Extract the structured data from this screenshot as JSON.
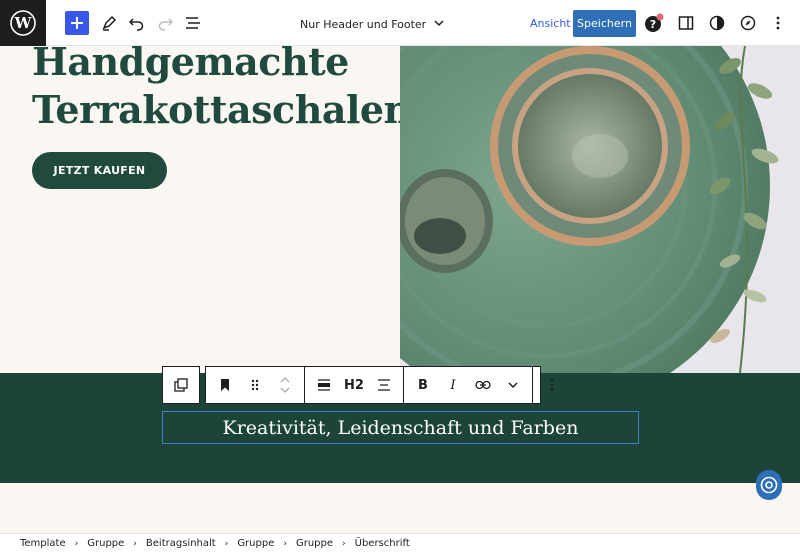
{
  "topbar": {
    "document_title": "Nur Header und Footer",
    "view_label": "Ansicht",
    "save_label": "Speichern"
  },
  "hero": {
    "title_line1": "Handgemachte",
    "title_line2": "Terrakottaschalen",
    "cta_label": "JETZT KAUFEN"
  },
  "band": {
    "heading": "Kreativität, Leidenschaft und Farben"
  },
  "block_toolbar": {
    "heading_level": "H2",
    "bold": "B",
    "italic": "I"
  },
  "breadcrumb": [
    "Template",
    "Gruppe",
    "Beitragsinhalt",
    "Gruppe",
    "Gruppe",
    "Überschrift"
  ],
  "colors": {
    "accent": "#3858e9",
    "save": "#2e6fb8",
    "brand_green": "#1f4a3d",
    "band_green": "#1c4438",
    "canvas": "#faf7f3"
  }
}
